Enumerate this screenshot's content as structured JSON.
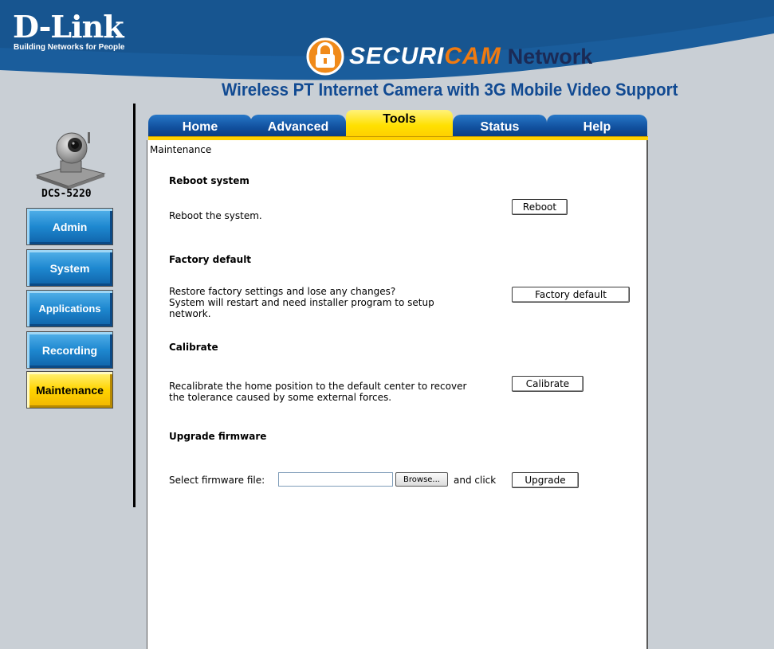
{
  "header": {
    "brand": "D-Link",
    "tagline": "Building Networks for People",
    "product_a": "SECURI",
    "product_b": "CAM",
    "product_c": "Network",
    "subtitle": "Wireless PT Internet Camera with 3G Mobile Video Support"
  },
  "sidebar": {
    "model": "DCS-5220",
    "items": [
      {
        "label": "Admin"
      },
      {
        "label": "System"
      },
      {
        "label": "Applications"
      },
      {
        "label": "Recording"
      },
      {
        "label": "Maintenance",
        "active": true
      }
    ]
  },
  "tabs": [
    {
      "label": "Home"
    },
    {
      "label": "Advanced"
    },
    {
      "label": "Tools",
      "active": true
    },
    {
      "label": "Status"
    },
    {
      "label": "Help"
    }
  ],
  "main": {
    "section_title": "Maintenance",
    "reboot": {
      "heading": "Reboot system",
      "description": "Reboot the system.",
      "button": "Reboot"
    },
    "factory": {
      "heading": "Factory default",
      "line1": "Restore factory settings and lose any changes?",
      "line2": "System will restart and need installer program to setup",
      "line3": "network.",
      "button": "Factory default"
    },
    "calibrate": {
      "heading": "Calibrate",
      "line1": "Recalibrate the home position to the default center to recover",
      "line2": "the tolerance caused by some external forces.",
      "button": "Calibrate"
    },
    "upgrade": {
      "heading": "Upgrade firmware",
      "label": "Select firmware file:",
      "file_value": "",
      "browse": "Browse...",
      "and_click": "and click",
      "button": "Upgrade"
    }
  },
  "colors": {
    "header_blue": "#1a5d9c",
    "tab_blue": "#11509e",
    "active_yellow": "#ffd400",
    "brand_orange": "#f07a10",
    "page_bg": "#c9cfd5"
  }
}
